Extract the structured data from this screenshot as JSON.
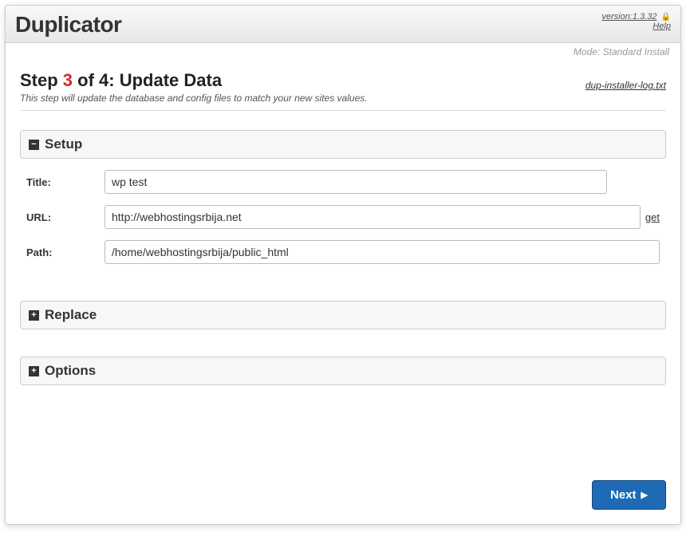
{
  "header": {
    "title": "Duplicator",
    "version_label": "version:1.3.32",
    "help_label": "Help",
    "lock_glyph": "🔒"
  },
  "mode_text": "Mode: Standard Install",
  "step": {
    "prefix": "Step ",
    "current": "3",
    "of_part": " of 4: ",
    "title": "Update Data",
    "subtitle": "This step will update the database and config files to match your new sites values."
  },
  "log_link": "dup-installer-log.txt",
  "panels": {
    "setup": {
      "toggle": "−",
      "title": "Setup",
      "fields": {
        "title_label": "Title:",
        "title_value": "wp test",
        "url_label": "URL:",
        "url_value": "http://webhostingsrbija.net",
        "get_label": "get",
        "path_label": "Path:",
        "path_value": "/home/webhostingsrbija/public_html"
      }
    },
    "replace": {
      "toggle": "+",
      "title": "Replace"
    },
    "options": {
      "toggle": "+",
      "title": "Options"
    }
  },
  "next_label": "Next",
  "next_arrow": "▶"
}
